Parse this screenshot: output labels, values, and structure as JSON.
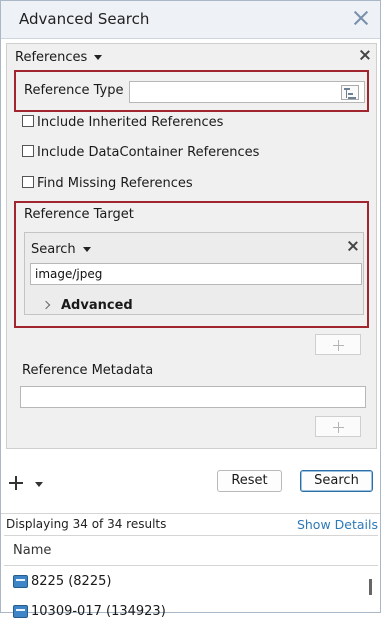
{
  "window": {
    "title": "Advanced Search"
  },
  "references": {
    "dropdown_label": "References",
    "reference_type": {
      "label": "Reference Type",
      "value": ""
    },
    "options": [
      {
        "label": "Include Inherited References",
        "checked": false
      },
      {
        "label": "Include DataContainer References",
        "checked": false
      },
      {
        "label": "Find Missing References",
        "checked": false
      }
    ],
    "reference_target": {
      "label": "Reference Target",
      "search_dropdown_label": "Search",
      "search_value": "image/jpeg",
      "advanced_label": "Advanced"
    },
    "reference_metadata": {
      "label": "Reference Metadata",
      "value": ""
    }
  },
  "actions": {
    "reset_label": "Reset",
    "search_label": "Search"
  },
  "results": {
    "summary": "Displaying 34 of 34 results",
    "show_details_label": "Show Details",
    "column_name": "Name",
    "rows": [
      {
        "label": "8225 (8225)"
      },
      {
        "label": "10309-017 (134923)"
      }
    ]
  },
  "colors": {
    "highlight_border": "#a1252f",
    "link": "#2c79b8",
    "primary_border": "#2f6ea3"
  }
}
